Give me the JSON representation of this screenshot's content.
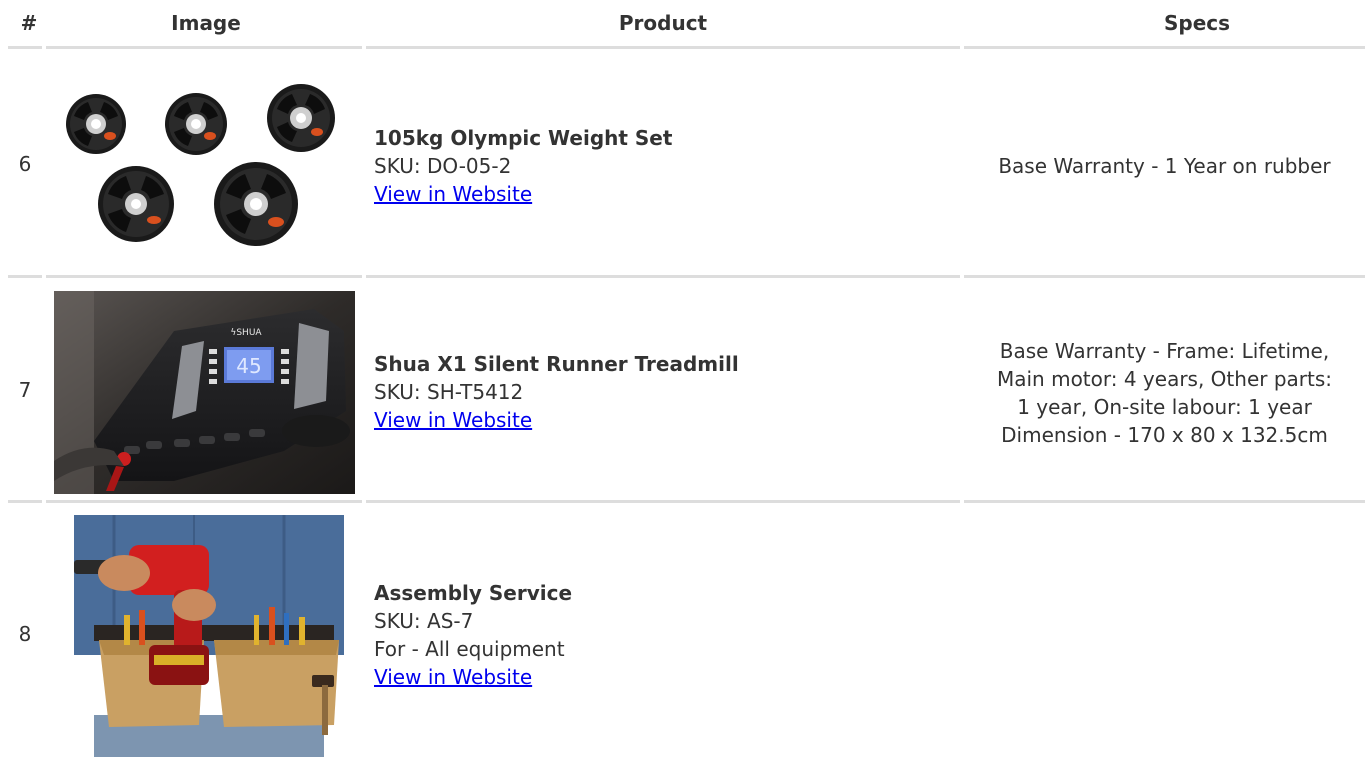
{
  "headers": {
    "num": "#",
    "image": "Image",
    "product": "Product",
    "specs": "Specs"
  },
  "rows": [
    {
      "num": "6",
      "image_icon": "weight-plates-image",
      "title": "105kg Olympic Weight Set",
      "sku": "SKU: DO-05-2",
      "link": "View in Website",
      "specs": [
        "Base Warranty - 1 Year on rubber"
      ]
    },
    {
      "num": "7",
      "image_icon": "treadmill-console-image",
      "title": "Shua X1 Silent Runner Treadmill",
      "sku": "SKU: SH-T5412",
      "link": "View in Website",
      "specs": [
        "Base Warranty - Frame: Lifetime,",
        "Main motor: 4 years, Other parts:",
        "1 year, On-site labour: 1 year",
        "Dimension - 170 x 80 x 132.5cm"
      ],
      "console_brand": "ϟSHUA",
      "console_display": "45"
    },
    {
      "num": "8",
      "image_icon": "tool-belt-drill-image",
      "title": "Assembly Service",
      "sku": "SKU: AS-7",
      "extra": "For - All equipment",
      "link": "View in Website",
      "specs": []
    }
  ],
  "colors": {
    "link": "#0000ee",
    "rule": "#dddddd",
    "text": "#333333"
  }
}
